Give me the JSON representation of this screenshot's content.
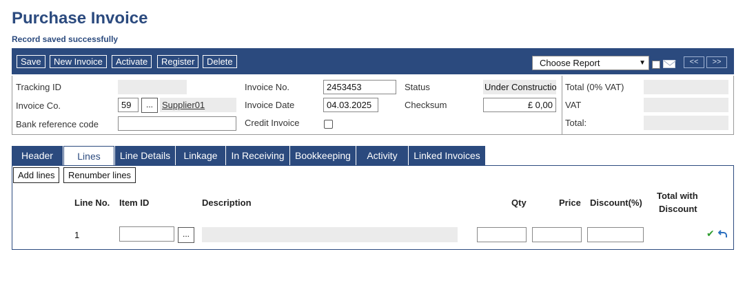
{
  "page": {
    "title": "Purchase Invoice",
    "message": "Record saved successfully"
  },
  "toolbar": {
    "buttons": [
      "Save",
      "New Invoice",
      "Activate",
      "Register",
      "Delete"
    ],
    "report_select": "Choose Report",
    "prev_label": "<<",
    "next_label": ">>"
  },
  "form": {
    "tracking_id_label": "Tracking ID",
    "tracking_id_value": "",
    "invoice_co_label": "Invoice Co.",
    "invoice_co_value": "59",
    "supplier_button": "...",
    "supplier_name": "Supplier01",
    "bank_ref_label": "Bank reference code",
    "bank_ref_value": "",
    "invoice_no_label": "Invoice No.",
    "invoice_no_value": "2453453",
    "invoice_date_label": "Invoice Date",
    "invoice_date_value": "04.03.2025",
    "credit_invoice_label": "Credit Invoice",
    "status_label": "Status",
    "status_value": "Under Construction",
    "checksum_label": "Checksum",
    "checksum_value": "£ 0,00",
    "total_excl_label": "Total (0% VAT)",
    "vat_label": "VAT",
    "total_label": "Total:"
  },
  "tabs": [
    "Header",
    "Lines",
    "Line Details",
    "Linkage",
    "In Receiving",
    "Bookkeeping",
    "Activity",
    "Linked Invoices"
  ],
  "active_tab": "Lines",
  "lines": {
    "add_lines_label": "Add lines",
    "renumber_label": "Renumber lines",
    "columns": {
      "line_no": "Line No.",
      "item_id": "Item ID",
      "description": "Description",
      "qty": "Qty",
      "price": "Price",
      "discount": "Discount(%)",
      "total_line1": "Total with",
      "total_line2": "Discount"
    },
    "rows": [
      {
        "line_no": "1",
        "item_button": "..."
      }
    ]
  },
  "colors": {
    "primary": "#2b4a7e",
    "readonly_bg": "#ebebeb",
    "ok_green": "#2e9c2e"
  },
  "icons": [
    "mail-icon",
    "check-icon",
    "undo-icon",
    "chevron-down-icon"
  ]
}
